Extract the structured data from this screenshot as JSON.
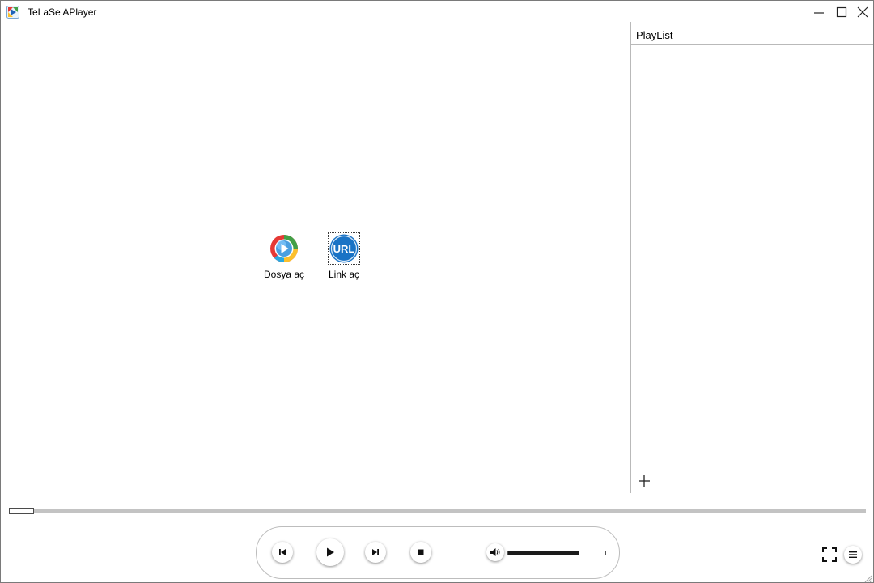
{
  "window": {
    "title": "TeLaSe APlayer"
  },
  "playlist": {
    "title": "PlayList",
    "add_icon": "plus-icon"
  },
  "open_actions": [
    {
      "label": "Dosya aç",
      "icon": "media-file-icon"
    },
    {
      "label": "Link aç",
      "icon": "url-link-icon",
      "icon_text": "URL"
    }
  ],
  "player": {
    "seek_progress": 0.0,
    "volume_level": 0.73,
    "colors": {
      "accent_blue": "#1a73c5",
      "track_gray": "#c3c3c3",
      "volume_fill": "#1b1b1b"
    }
  }
}
